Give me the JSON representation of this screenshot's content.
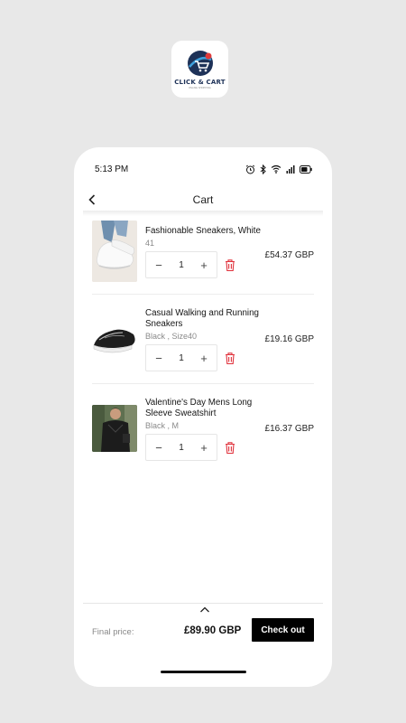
{
  "app": {
    "logo_text": "CLICK & CART",
    "logo_tagline": "ONLINE SHOPPING"
  },
  "status_bar": {
    "time": "5:13 PM"
  },
  "header": {
    "title": "Cart"
  },
  "cart_items": [
    {
      "title": "Fashionable Sneakers, White",
      "variant": "41",
      "quantity": "1",
      "price": "£54.37 GBP"
    },
    {
      "title": "Casual Walking and Running Sneakers",
      "variant": "Black , Size40",
      "quantity": "1",
      "price": "£19.16 GBP"
    },
    {
      "title": "Valentine's Day Mens Long Sleeve Sweatshirt",
      "variant": "Black , M",
      "quantity": "1",
      "price": "£16.37 GBP"
    }
  ],
  "footer": {
    "final_label": "Final price:",
    "final_total": "£89.90 GBP",
    "checkout_label": "Check out"
  },
  "colors": {
    "accent": "#000000",
    "delete": "#e0313b"
  }
}
